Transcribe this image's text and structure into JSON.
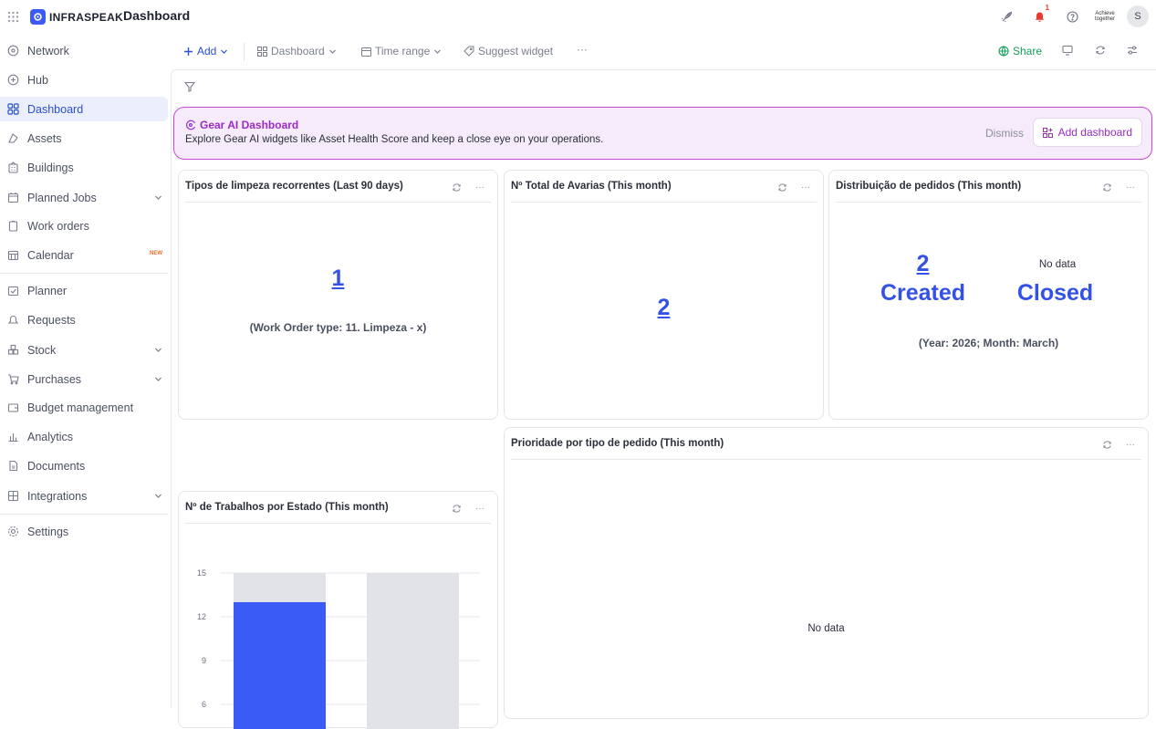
{
  "app": {
    "brand": "INFRASPEAK",
    "page_title": "Dashboard",
    "notification_count": "1",
    "avatar_initial": "S",
    "org_logo_text": "Achieve together"
  },
  "sidebar": {
    "items": [
      {
        "label": "Network",
        "icon": "globe-icon"
      },
      {
        "label": "Hub",
        "icon": "hub-icon"
      },
      {
        "label": "Dashboard",
        "icon": "dashboard-icon"
      },
      {
        "label": "Assets",
        "icon": "assets-icon"
      },
      {
        "label": "Buildings",
        "icon": "building-icon"
      },
      {
        "label": "Planned Jobs",
        "icon": "calendar-check-icon"
      },
      {
        "label": "Work orders",
        "icon": "clipboard-icon"
      },
      {
        "label": "Calendar",
        "icon": "calendar-icon",
        "badge": "NEW"
      },
      {
        "label": "Planner",
        "icon": "planner-icon"
      },
      {
        "label": "Requests",
        "icon": "bell-icon"
      },
      {
        "label": "Stock",
        "icon": "stock-icon"
      },
      {
        "label": "Purchases",
        "icon": "cart-icon"
      },
      {
        "label": "Budget management",
        "icon": "wallet-icon"
      },
      {
        "label": "Analytics",
        "icon": "bar-chart-icon"
      },
      {
        "label": "Documents",
        "icon": "document-icon"
      },
      {
        "label": "Integrations",
        "icon": "integrations-icon"
      },
      {
        "label": "Settings",
        "icon": "gear-icon"
      }
    ]
  },
  "toolbar": {
    "add": "Add",
    "dashboard": "Dashboard",
    "time_range": "Time range",
    "suggest": "Suggest widget",
    "more": "···",
    "share": "Share"
  },
  "banner": {
    "title": "Gear AI Dashboard",
    "text": "Explore Gear AI widgets like Asset Health Score and keep a close eye on your operations.",
    "dismiss": "Dismiss",
    "add_dashboard": "Add dashboard"
  },
  "widgets": {
    "w1": {
      "title": "Tipos de limpeza recorrentes (Last 90 days)",
      "value": "1",
      "caption": "(Work Order type: 11. Limpeza - x)"
    },
    "w2": {
      "title": "Nº Total de Avarias (This month)",
      "value": "2"
    },
    "w3": {
      "title": "Distribuição de pedidos (This month)",
      "created_value": "2",
      "created_label": "Created",
      "closed_nodata": "No data",
      "closed_label": "Closed",
      "caption": "(Year: 2026; Month: March)"
    },
    "w4": {
      "title": "Prioridade por tipo de pedido (This month)",
      "nodata": "No data"
    },
    "w5": {
      "title": "Nº de Trabalhos por Estado (This month)"
    }
  },
  "chart_data": {
    "type": "bar",
    "title": "Nº de Trabalhos por Estado (This month)",
    "y_ticks": [
      15,
      12,
      9,
      6
    ],
    "series": [
      {
        "values": [
          13,
          null
        ],
        "color": "#3b5bf6"
      },
      {
        "values": [
          15,
          15
        ],
        "color": "#e2e3e8"
      }
    ],
    "ylim": [
      6,
      15
    ],
    "grid": true
  }
}
